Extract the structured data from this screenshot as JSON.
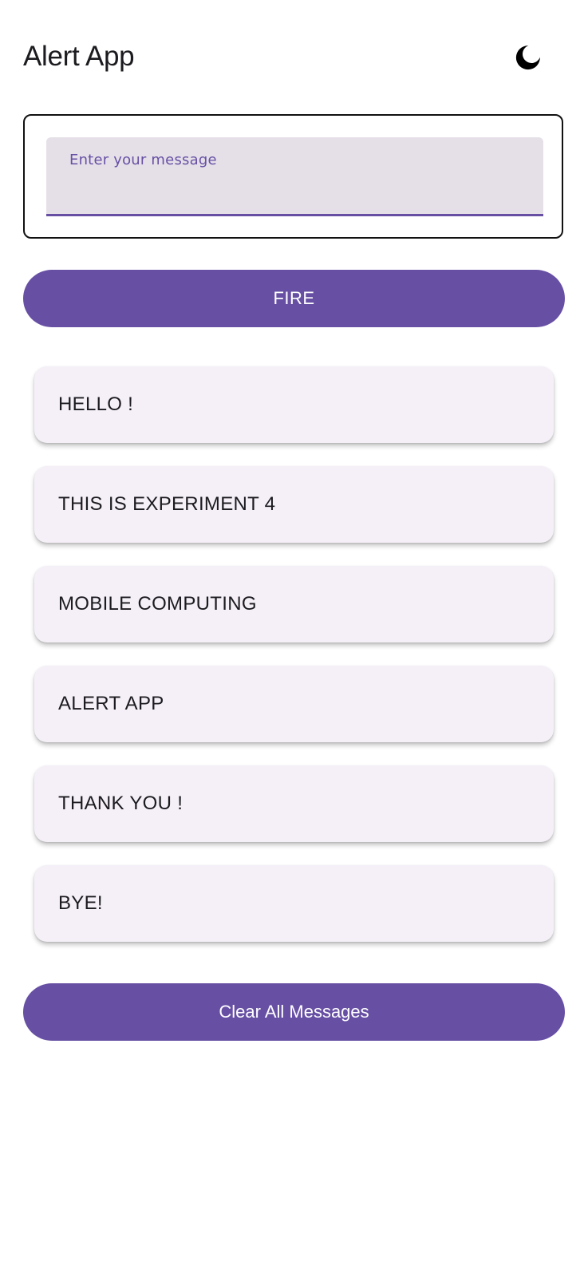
{
  "header": {
    "title": "Alert App",
    "theme_icon": "moon-icon"
  },
  "input": {
    "placeholder": "Enter your message",
    "value": ""
  },
  "actions": {
    "fire_label": "FIRE",
    "clear_label": "Clear All Messages"
  },
  "messages": [
    "HELLO !",
    "THIS IS EXPERIMENT 4",
    "MOBILE COMPUTING",
    "ALERT APP",
    "THANK YOU !",
    "BYE!"
  ],
  "colors": {
    "accent": "#6750a4",
    "card_background": "#f5f0f8",
    "field_background": "#e5e0e8"
  }
}
